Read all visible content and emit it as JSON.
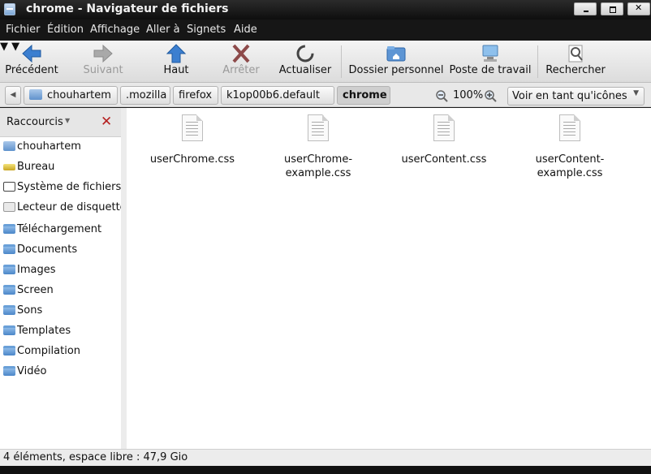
{
  "window": {
    "title": "chrome - Navigateur de fichiers"
  },
  "menu": [
    "Fichier",
    "Édition",
    "Affichage",
    "Aller à",
    "Signets",
    "Aide"
  ],
  "toolbar": {
    "back": "Précédent",
    "forward": "Suivant",
    "up": "Haut",
    "stop": "Arrêter",
    "reload": "Actualiser",
    "home": "Dossier personnel",
    "desktop": "Poste de travail",
    "search": "Rechercher"
  },
  "path": [
    "chouhartem",
    ".mozilla",
    "firefox",
    "k1op00b6.default",
    "chrome"
  ],
  "zoom": "100%",
  "view_mode": "Voir en tant qu'icônes",
  "sidebar": {
    "header": "Raccourcis",
    "items": [
      "chouhartem",
      "Bureau",
      "Système de fichiers",
      "Lecteur de disquette",
      "Téléchargement",
      "Documents",
      "Images",
      "Screen",
      "Sons",
      "Templates",
      "Compilation",
      "Vidéo"
    ]
  },
  "files": [
    {
      "line1": "userChrome.css",
      "line2": ""
    },
    {
      "line1": "userChrome-",
      "line2": "example.css"
    },
    {
      "line1": "userContent.css",
      "line2": ""
    },
    {
      "line1": "userContent-",
      "line2": "example.css"
    }
  ],
  "status": "4 éléments, espace libre : 47,9 Gio"
}
